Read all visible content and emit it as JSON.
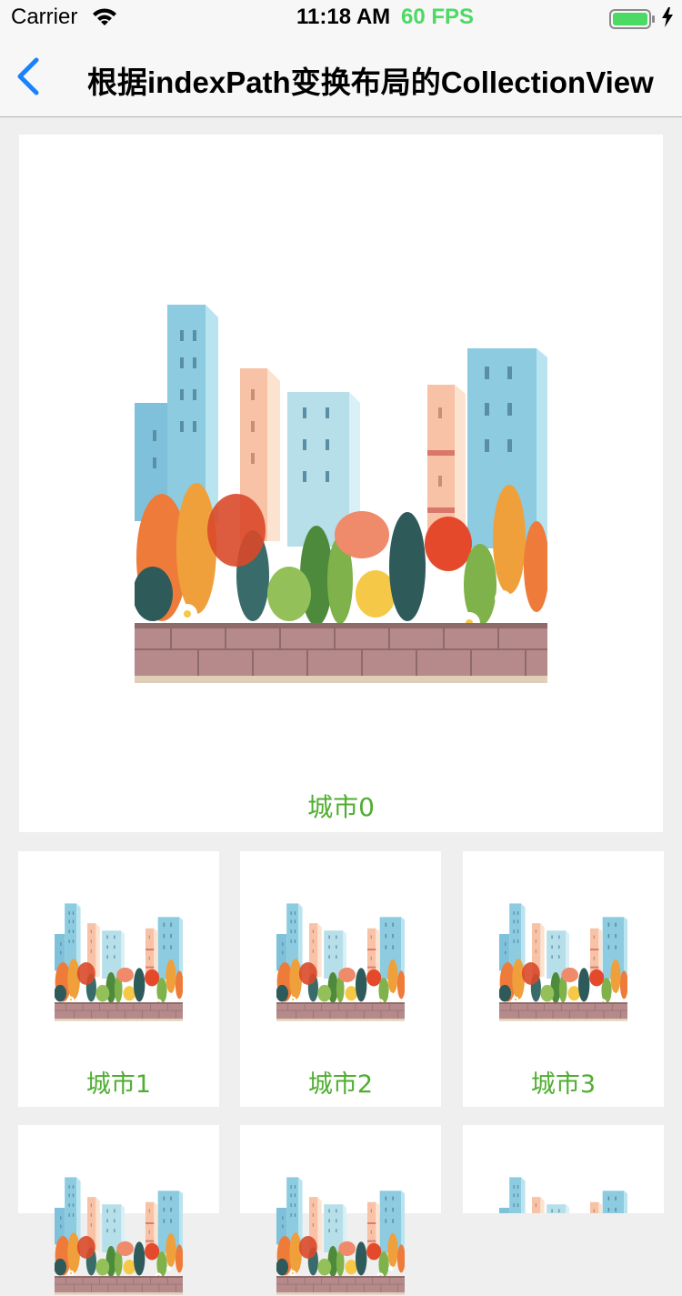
{
  "status_bar": {
    "carrier": "Carrier",
    "time": "11:18 AM",
    "fps": "60 FPS",
    "icons": [
      "wifi-icon",
      "battery-icon",
      "charging-bolt-icon"
    ]
  },
  "nav": {
    "title": "根据indexPath变换布局的CollectionView",
    "back_icon": "chevron-left-icon",
    "accent": "#1a82fb"
  },
  "cells": [
    {
      "label": "城市0"
    },
    {
      "label": "城市1"
    },
    {
      "label": "城市2"
    },
    {
      "label": "城市3"
    },
    {
      "label": ""
    },
    {
      "label": ""
    },
    {
      "label": ""
    }
  ],
  "colors": {
    "label_green": "#4fae30",
    "background": "#efefef",
    "cell_background": "#ffffff"
  }
}
